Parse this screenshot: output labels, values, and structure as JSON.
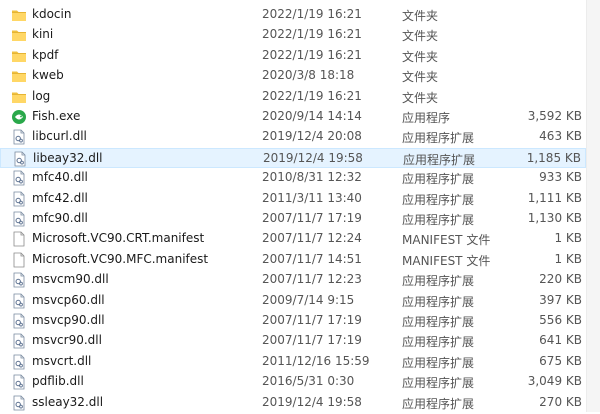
{
  "files": [
    {
      "name": "kdocin",
      "date": "2022/1/19 16:21",
      "type": "文件夹",
      "size": "",
      "icon": "folder-icon"
    },
    {
      "name": "kini",
      "date": "2022/1/19 16:21",
      "type": "文件夹",
      "size": "",
      "icon": "folder-icon"
    },
    {
      "name": "kpdf",
      "date": "2022/1/19 16:21",
      "type": "文件夹",
      "size": "",
      "icon": "folder-icon"
    },
    {
      "name": "kweb",
      "date": "2020/3/8 18:18",
      "type": "文件夹",
      "size": "",
      "icon": "folder-icon"
    },
    {
      "name": "log",
      "date": "2022/1/19 16:21",
      "type": "文件夹",
      "size": "",
      "icon": "folder-icon"
    },
    {
      "name": "Fish.exe",
      "date": "2020/9/14 14:14",
      "type": "应用程序",
      "size": "3,592 KB",
      "icon": "fish-app-icon"
    },
    {
      "name": "libcurl.dll",
      "date": "2019/12/4 20:08",
      "type": "应用程序扩展",
      "size": "463 KB",
      "icon": "dll-file-icon"
    },
    {
      "name": "libeay32.dll",
      "date": "2019/12/4 19:58",
      "type": "应用程序扩展",
      "size": "1,185 KB",
      "icon": "dll-file-icon"
    },
    {
      "name": "mfc40.dll",
      "date": "2010/8/31 12:32",
      "type": "应用程序扩展",
      "size": "933 KB",
      "icon": "dll-file-icon"
    },
    {
      "name": "mfc42.dll",
      "date": "2011/3/11 13:40",
      "type": "应用程序扩展",
      "size": "1,111 KB",
      "icon": "dll-file-icon"
    },
    {
      "name": "mfc90.dll",
      "date": "2007/11/7 17:19",
      "type": "应用程序扩展",
      "size": "1,130 KB",
      "icon": "dll-file-icon"
    },
    {
      "name": "Microsoft.VC90.CRT.manifest",
      "date": "2007/11/7 12:24",
      "type": "MANIFEST 文件",
      "size": "1 KB",
      "icon": "blank-file-icon"
    },
    {
      "name": "Microsoft.VC90.MFC.manifest",
      "date": "2007/11/7 14:51",
      "type": "MANIFEST 文件",
      "size": "1 KB",
      "icon": "blank-file-icon"
    },
    {
      "name": "msvcm90.dll",
      "date": "2007/11/7 12:23",
      "type": "应用程序扩展",
      "size": "220 KB",
      "icon": "dll-file-icon"
    },
    {
      "name": "msvcp60.dll",
      "date": "2009/7/14 9:15",
      "type": "应用程序扩展",
      "size": "397 KB",
      "icon": "dll-file-icon"
    },
    {
      "name": "msvcp90.dll",
      "date": "2007/11/7 17:19",
      "type": "应用程序扩展",
      "size": "556 KB",
      "icon": "dll-file-icon"
    },
    {
      "name": "msvcr90.dll",
      "date": "2007/11/7 17:19",
      "type": "应用程序扩展",
      "size": "641 KB",
      "icon": "dll-file-icon"
    },
    {
      "name": "msvcrt.dll",
      "date": "2011/12/16 15:59",
      "type": "应用程序扩展",
      "size": "675 KB",
      "icon": "dll-file-icon"
    },
    {
      "name": "pdflib.dll",
      "date": "2016/5/31 0:30",
      "type": "应用程序扩展",
      "size": "3,049 KB",
      "icon": "dll-file-icon"
    },
    {
      "name": "ssleay32.dll",
      "date": "2019/12/4 19:58",
      "type": "应用程序扩展",
      "size": "270 KB",
      "icon": "dll-file-icon"
    }
  ],
  "selected_file": "libeay32.dll",
  "colors": {
    "folder": "#f0c040",
    "folder_dark": "#d9a520",
    "selection_bg": "#e5f3ff",
    "selection_border": "#cce8ff",
    "fish_green": "#2aa84a"
  }
}
